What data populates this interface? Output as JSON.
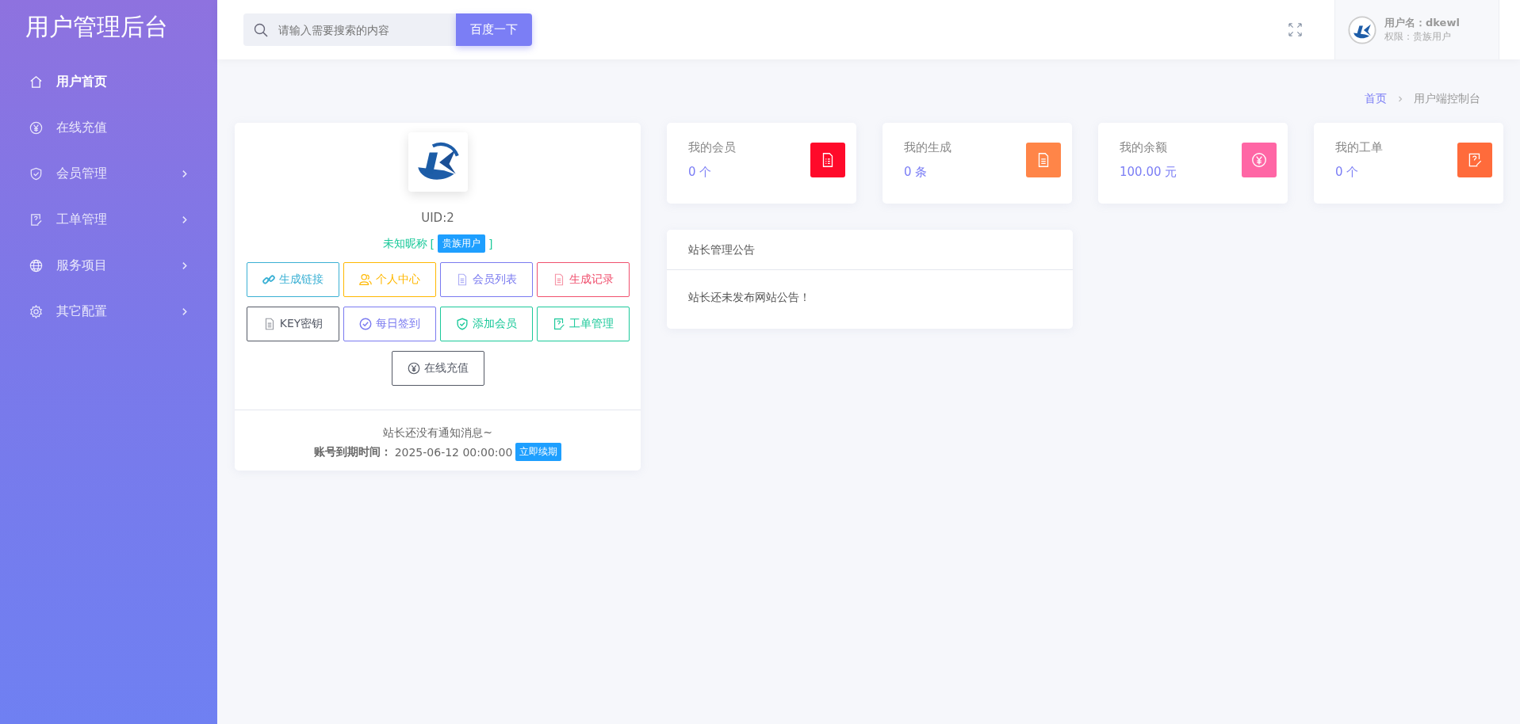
{
  "sidebar": {
    "title": "用户管理后台",
    "items": [
      {
        "label": "用户首页",
        "kind": "home",
        "selected": true,
        "expandable": false
      },
      {
        "label": "在线充值",
        "kind": "yen",
        "selected": false,
        "expandable": false
      },
      {
        "label": "会员管理",
        "kind": "shield",
        "selected": false,
        "expandable": true
      },
      {
        "label": "工单管理",
        "kind": "ticket",
        "selected": false,
        "expandable": true
      },
      {
        "label": "服务项目",
        "kind": "globe",
        "selected": false,
        "expandable": true
      },
      {
        "label": "其它配置",
        "kind": "gear",
        "selected": false,
        "expandable": true
      }
    ]
  },
  "topbar": {
    "search": {
      "placeholder": "请输入需要搜索的内容"
    },
    "search_button": "百度一下",
    "user": {
      "name_label": "用户名：",
      "name": "dkewl",
      "role": "权限：贵族用户"
    }
  },
  "breadcrumb": [
    {
      "label": "首页",
      "selected": false
    },
    {
      "label": "用户端控制台",
      "selected": true
    }
  ],
  "profile": {
    "uid": "UID:2",
    "nickname": "未知昵称",
    "bracket_open": "[",
    "badge": "贵族用户",
    "bracket_close": "]",
    "actions": [
      {
        "label": "生成链接",
        "kind": "link",
        "color": "#3ab0d4"
      },
      {
        "label": "个人中心",
        "kind": "user",
        "color": "#ffb800"
      },
      {
        "label": "会员列表",
        "kind": "doc",
        "color": "#7a7af0"
      },
      {
        "label": "生成记录",
        "kind": "doc",
        "color": "#f0506e"
      },
      {
        "label": "KEY密钥",
        "kind": "doc",
        "color": "#555a66"
      },
      {
        "label": "每日签到",
        "kind": "check",
        "color": "#7a7af0"
      },
      {
        "label": "添加会员",
        "kind": "shield",
        "color": "#1bc99a"
      },
      {
        "label": "工单管理",
        "kind": "ticket",
        "color": "#1bc99a"
      },
      {
        "label": "在线充值",
        "kind": "yen",
        "color": "#555a66"
      }
    ],
    "notice": "站长还没有通知消息~",
    "expiry_label": "账号到期时间：",
    "expiry": "2025-06-12 00:00:00",
    "renew_button": "立即续期"
  },
  "stats": [
    {
      "title": "我的会员",
      "value": "0 个",
      "kind": "list",
      "color": "#ff0a2a"
    },
    {
      "title": "我的生成",
      "value": "0 条",
      "kind": "doc",
      "color": "#ff8548"
    },
    {
      "title": "我的余额",
      "value": "100.00 元",
      "kind": "yen",
      "color": "#ff66a5"
    },
    {
      "title": "我的工单",
      "value": "0 个",
      "kind": "ticket",
      "color": "#ff6b3b"
    }
  ],
  "announcement": {
    "title": "站长管理公告",
    "body": "站长还未发布网站公告！"
  }
}
